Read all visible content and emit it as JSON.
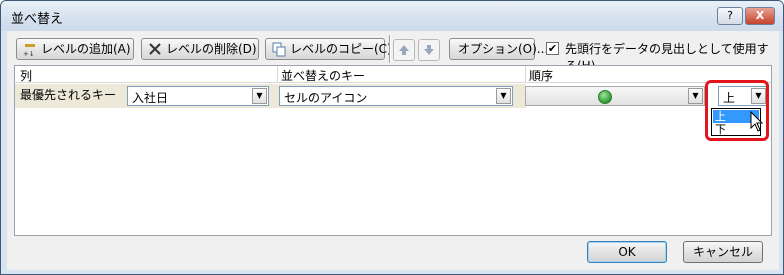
{
  "window": {
    "title": "並べ替え",
    "help_label": "?",
    "close_label": "X"
  },
  "toolbar": {
    "add_level": "レベルの追加(A)",
    "delete_level": "レベルの削除(D)",
    "copy_level": "レベルのコピー(C)",
    "options": "オプション(O)...",
    "has_headers_label": "先頭行をデータの見出しとして使用する(H)",
    "has_headers_checked": true
  },
  "grid": {
    "headers": {
      "column": "列",
      "sort_on": "並べ替えのキー",
      "order": "順序"
    },
    "row": {
      "label": "最優先されるキー",
      "column_value": "入社日",
      "sort_on_value": "セルのアイコン",
      "order_value": "上"
    }
  },
  "dropdown": {
    "options": [
      "上",
      "下"
    ],
    "highlighted": "上"
  },
  "footer": {
    "ok": "OK",
    "cancel": "キャンセル"
  },
  "colors": {
    "highlight_border": "#e2141c",
    "icon_color": "#2f9b33",
    "selection": "#3399ff"
  }
}
